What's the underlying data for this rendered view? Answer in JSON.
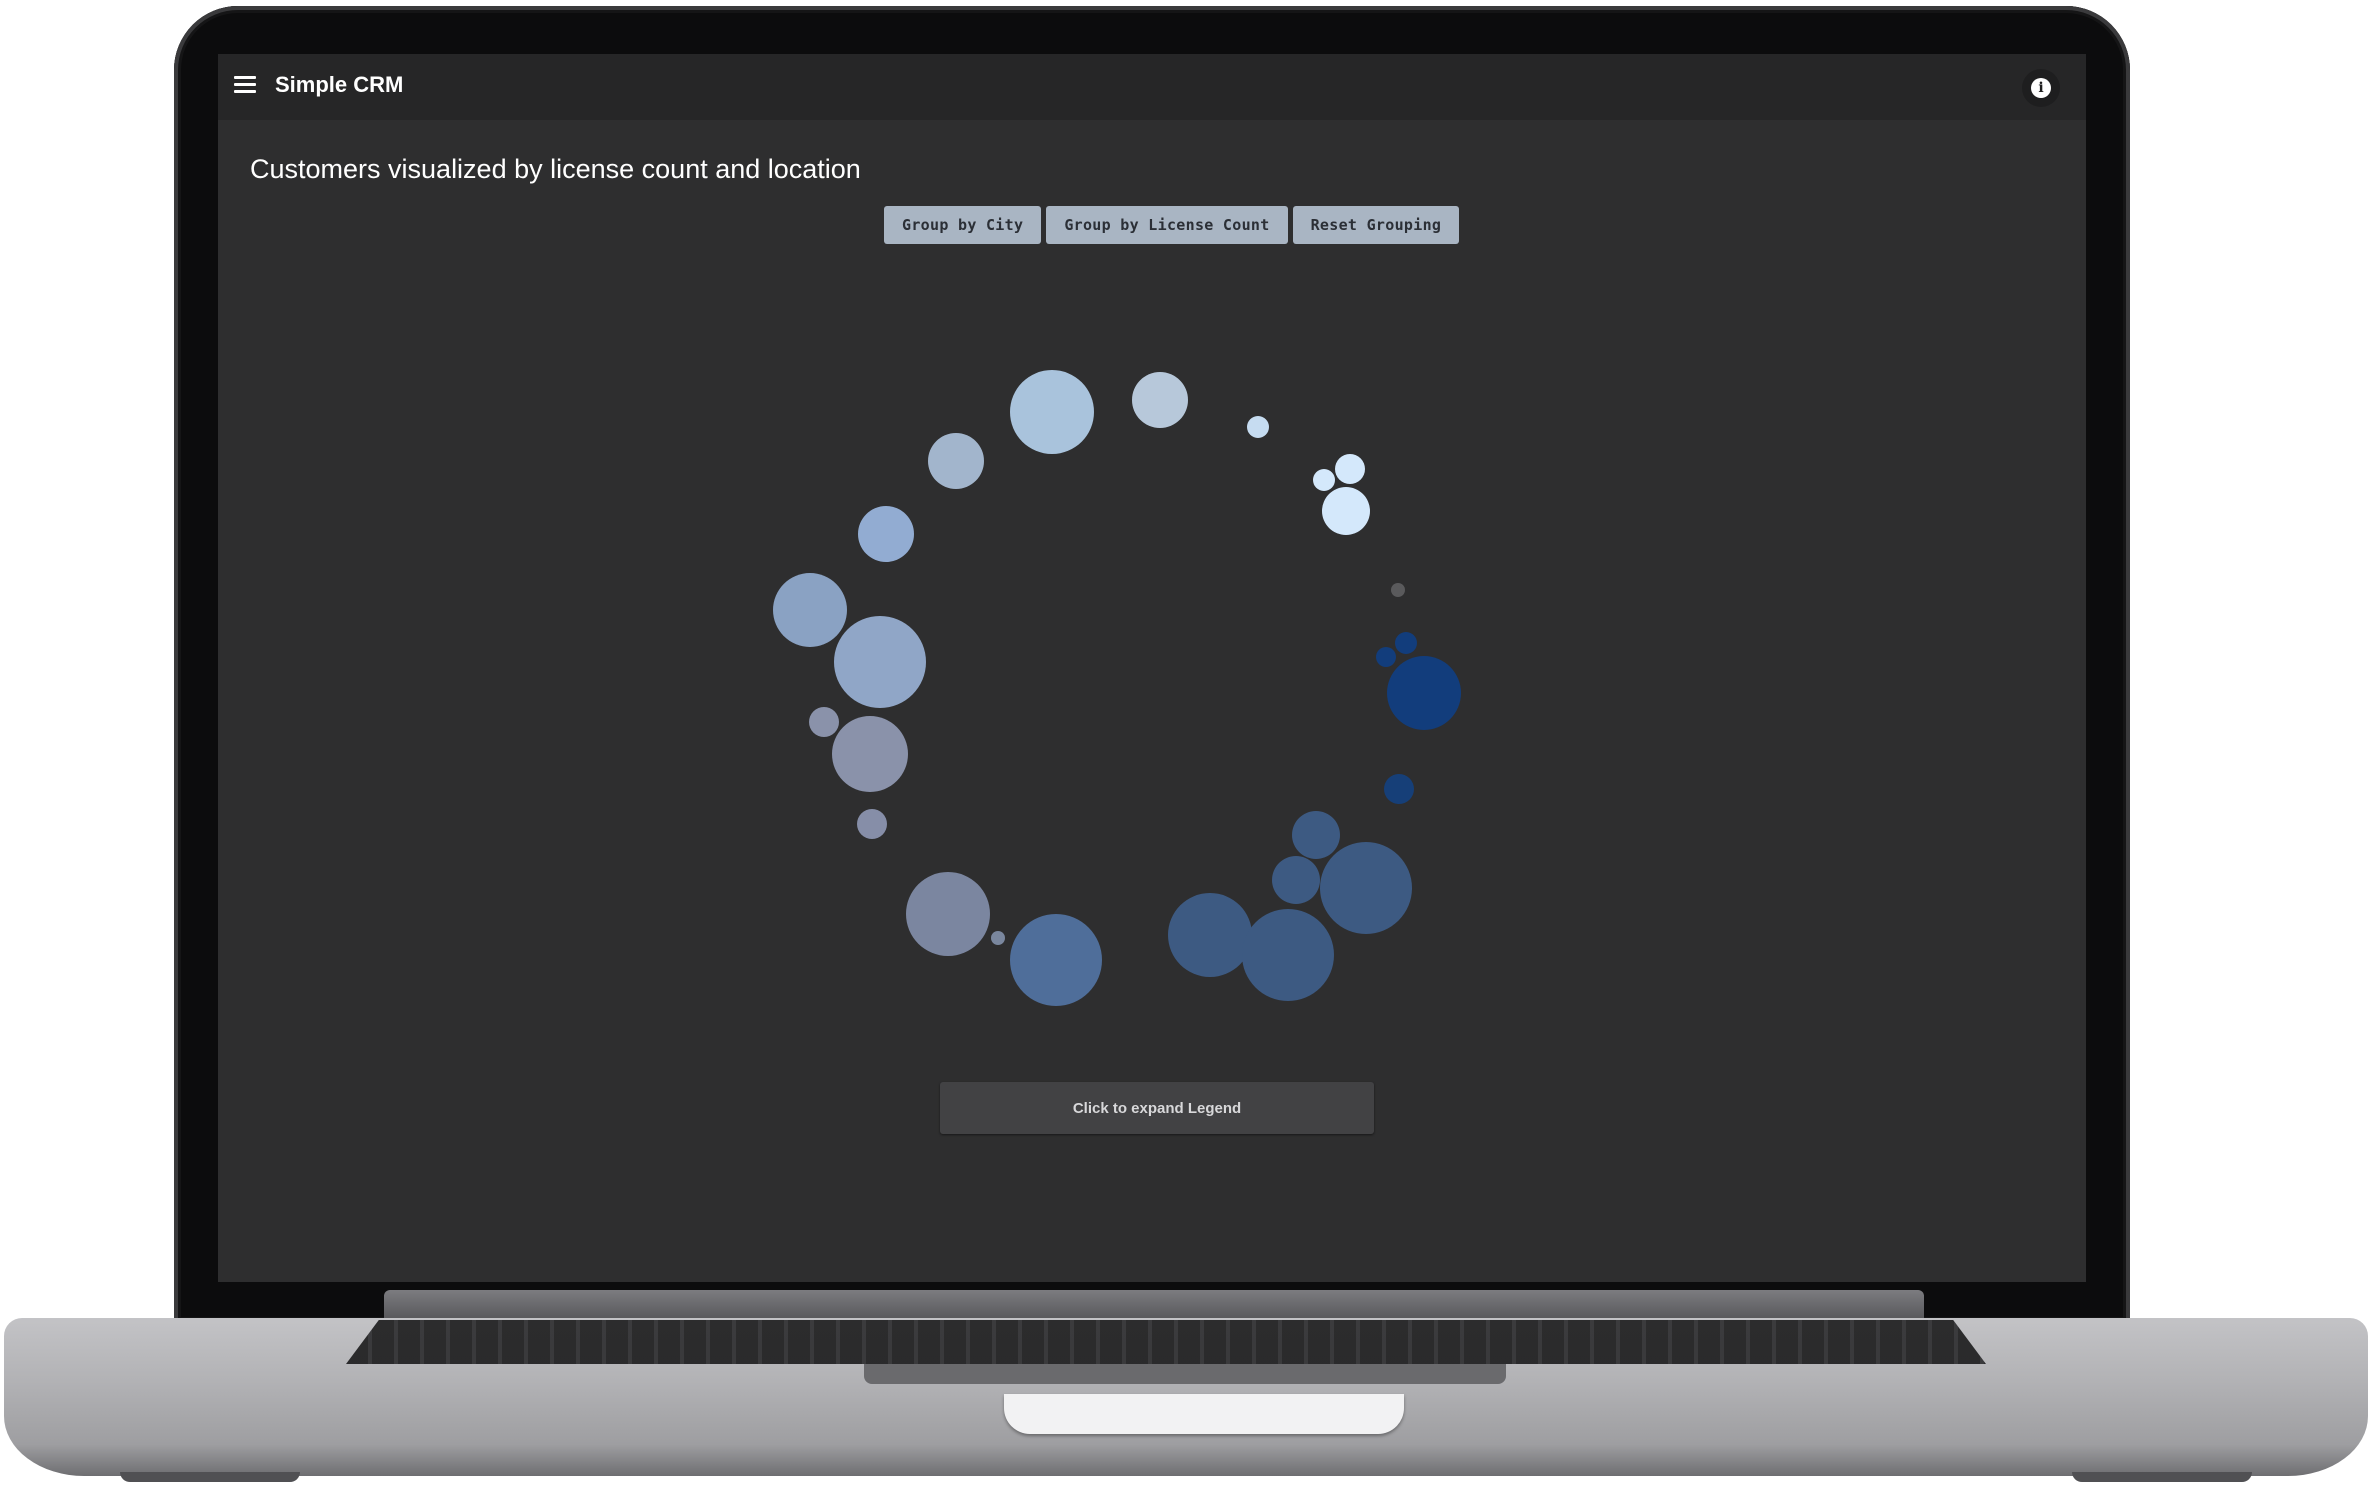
{
  "app": {
    "title": "Simple CRM",
    "menu_icon": "hamburger-menu-icon",
    "info_icon": "info-icon",
    "info_glyph": "i"
  },
  "page": {
    "heading": "Customers visualized by license count and location"
  },
  "grouping_buttons": [
    {
      "label": "Group by City"
    },
    {
      "label": "Group by License Count"
    },
    {
      "label": "Reset Grouping"
    }
  ],
  "legend": {
    "toggle_label": "Click to expand Legend"
  },
  "colors": {
    "screen_bg": "#2e2e2f",
    "appbar_bg": "#262627",
    "button_bg": "#a9b5c3",
    "legend_bg": "#424244"
  }
}
